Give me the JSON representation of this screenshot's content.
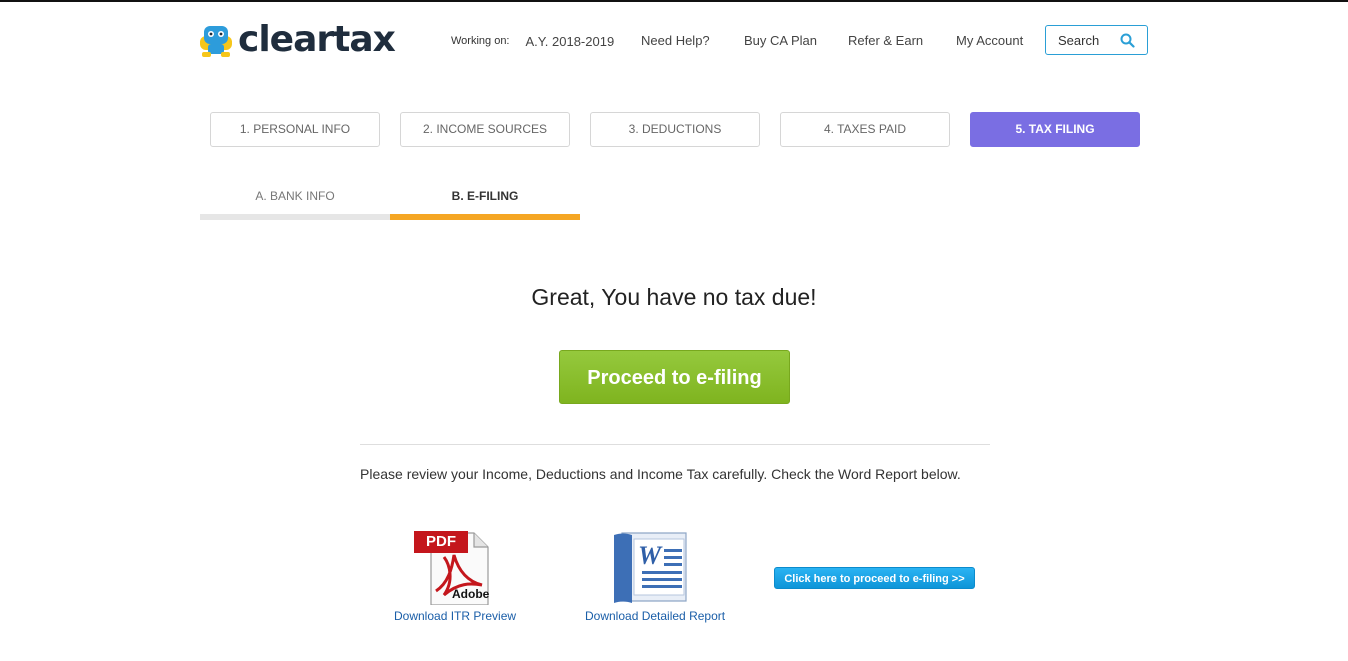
{
  "brand": {
    "logo_text": "cleartax"
  },
  "header": {
    "working_label": "Working on:",
    "working_value": "A.Y. 2018-2019",
    "need_help": "Need Help?",
    "buy_ca": "Buy CA Plan",
    "refer": "Refer & Earn",
    "account": "My Account",
    "search_label": "Search",
    "search_icon": "search-icon"
  },
  "steps": [
    {
      "label": "1. PERSONAL INFO"
    },
    {
      "label": "2. INCOME SOURCES"
    },
    {
      "label": "3. DEDUCTIONS"
    },
    {
      "label": "4. TAXES PAID"
    },
    {
      "label": "5. TAX FILING"
    }
  ],
  "subtabs": [
    {
      "label": "A. BANK INFO"
    },
    {
      "label": "B. E-FILING"
    }
  ],
  "main": {
    "headline": "Great, You have no tax due!",
    "proceed_label": "Proceed to e-filing",
    "review_text": "Please review your Income, Deductions and Income Tax carefully. Check the Word Report below.",
    "pdf_badge": "PDF",
    "pdf_brand": "Adobe",
    "download_itr": "Download ITR Preview",
    "word_letter": "W",
    "download_report": "Download Detailed Report",
    "efile_button": "Click here to proceed to e-filing >>"
  },
  "colors": {
    "active_step": "#7a6ee3",
    "active_tab_underline": "#f5a623",
    "proceed_green": "#8cbf2f",
    "link_blue": "#1a5ea8",
    "search_border": "#2a9fd6"
  }
}
